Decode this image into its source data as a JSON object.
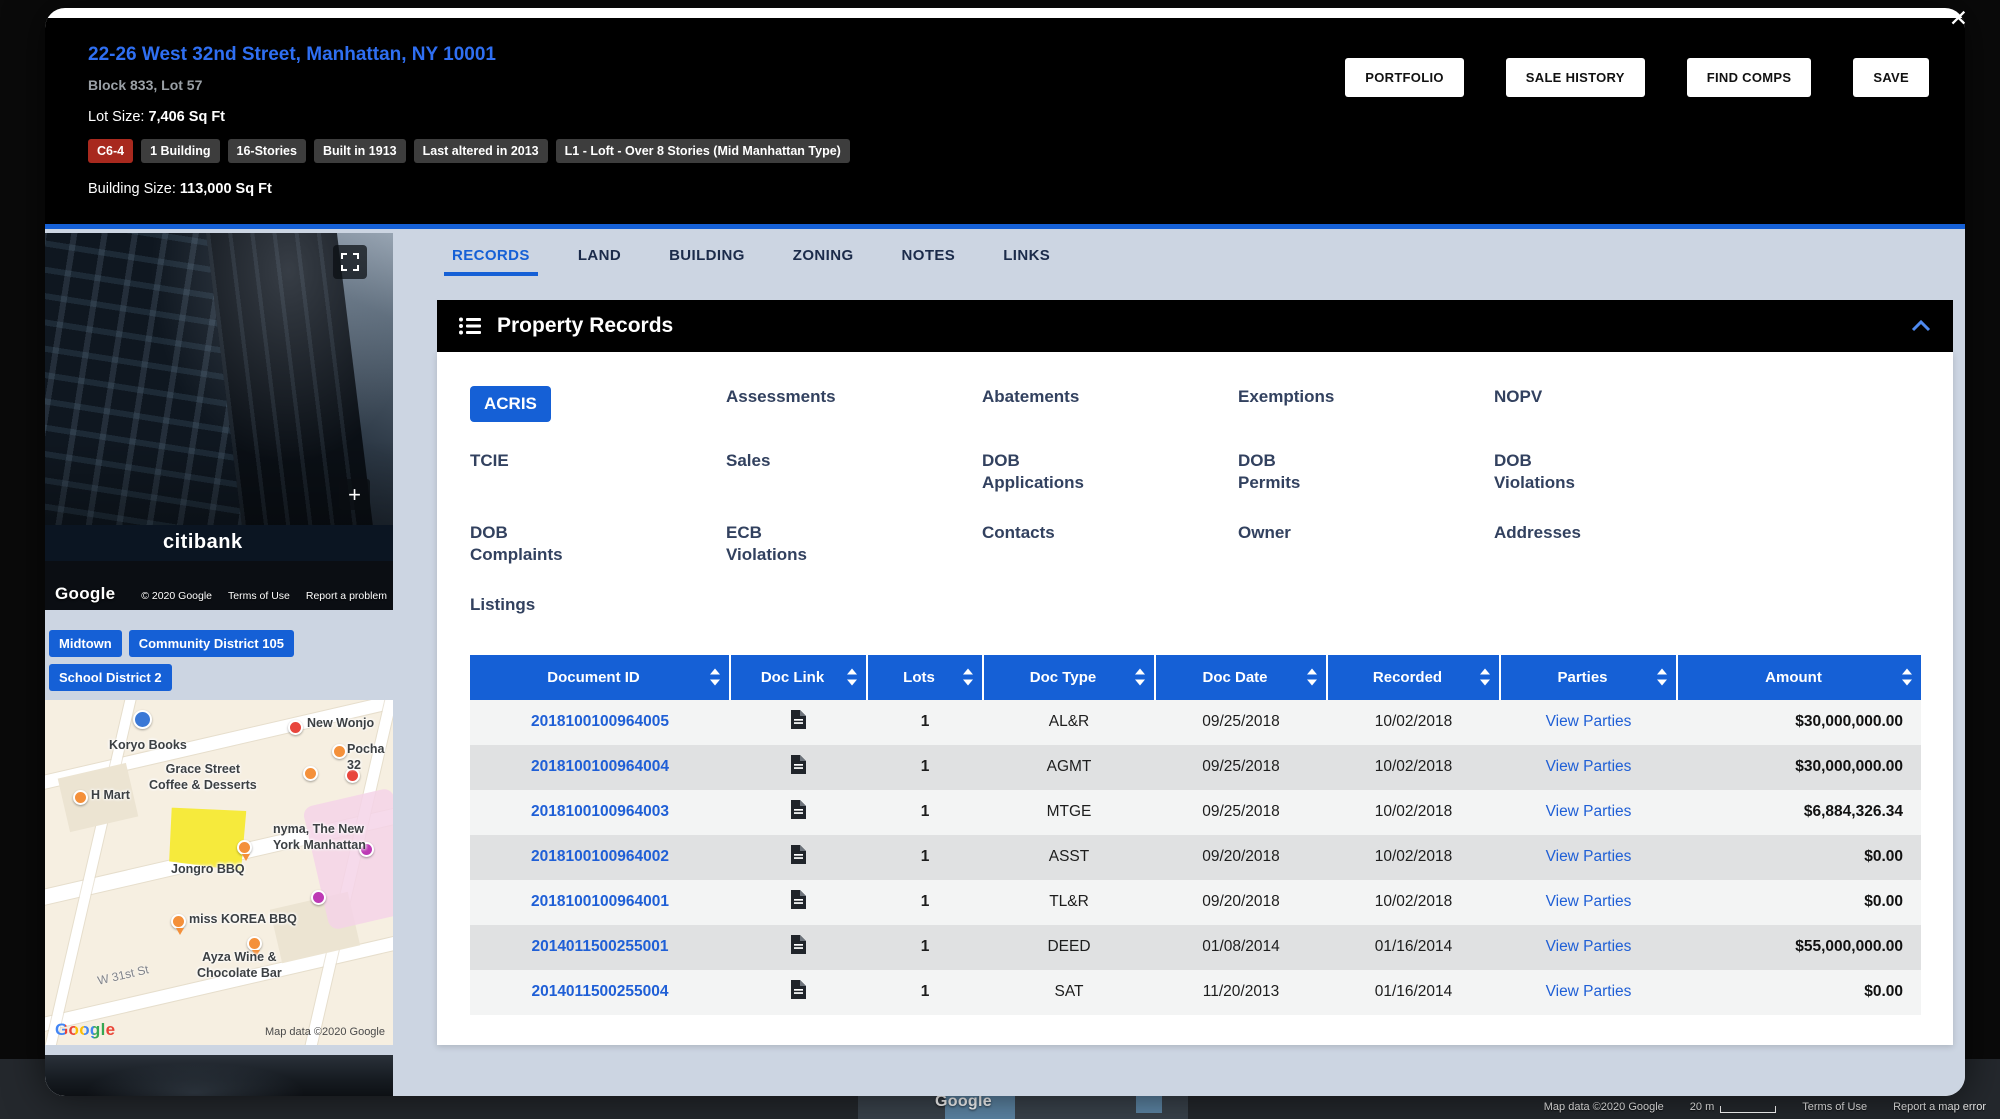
{
  "window": {
    "close_glyph": "✕"
  },
  "header": {
    "title": "22-26 West 32nd Street, Manhattan, NY 10001",
    "block_lot": "Block 833, Lot 57",
    "lot_size_label": "Lot Size:",
    "lot_size_value": "7,406 Sq Ft",
    "tags": [
      "C6-4",
      "1 Building",
      "16-Stories",
      "Built in 1913",
      "Last altered in 2013",
      "L1 - Loft - Over 8 Stories (Mid Manhattan Type)"
    ],
    "building_size_label": "Building Size:",
    "building_size_value": "113,000 Sq Ft",
    "buttons": [
      "PORTFOLIO",
      "SALE HISTORY",
      "FIND COMPS",
      "SAVE"
    ]
  },
  "sidebar": {
    "streetview": {
      "sign": "citibank",
      "zoom_in": "+",
      "google_logo": "Google",
      "copyright": "© 2020 Google",
      "terms": "Terms of Use",
      "report": "Report a problem"
    },
    "tags": [
      "Midtown",
      "Community District 105",
      "School District 2"
    ],
    "map": {
      "pois": [
        "Koryo Books",
        "New Wonjo",
        "Pocha 32",
        "Grace Street\nCoffee & Desserts",
        "H Mart",
        "nyma, The New\nYork Manhattan",
        "Jongro BBQ",
        "miss KOREA BBQ",
        "Ayza Wine &\nChocolate Bar"
      ],
      "street_label": "W 31st St",
      "google_logo": "Google",
      "attribution": "Map data ©2020 Google"
    }
  },
  "tabs": [
    "RECORDS",
    "LAND",
    "BUILDING",
    "ZONING",
    "NOTES",
    "LINKS"
  ],
  "records_panel": {
    "title": "Property Records",
    "nav": [
      "ACRIS",
      "Assessments",
      "Abatements",
      "Exemptions",
      "NOPV",
      "TCIE",
      "Sales",
      "DOB\nApplications",
      "DOB\nPermits",
      "DOB\nViolations",
      "DOB\nComplaints",
      "ECB\nViolations",
      "Contacts",
      "Owner",
      "Addresses",
      "Listings"
    ]
  },
  "table": {
    "columns": [
      "Document ID",
      "Doc Link",
      "Lots",
      "Doc Type",
      "Doc Date",
      "Recorded",
      "Parties",
      "Amount"
    ],
    "rows": [
      {
        "document_id": "2018100100964005",
        "lots": "1",
        "doc_type": "AL&R",
        "doc_date": "09/25/2018",
        "recorded": "10/02/2018",
        "parties": "View Parties",
        "amount": "$30,000,000.00"
      },
      {
        "document_id": "2018100100964004",
        "lots": "1",
        "doc_type": "AGMT",
        "doc_date": "09/25/2018",
        "recorded": "10/02/2018",
        "parties": "View Parties",
        "amount": "$30,000,000.00"
      },
      {
        "document_id": "2018100100964003",
        "lots": "1",
        "doc_type": "MTGE",
        "doc_date": "09/25/2018",
        "recorded": "10/02/2018",
        "parties": "View Parties",
        "amount": "$6,884,326.34"
      },
      {
        "document_id": "2018100100964002",
        "lots": "1",
        "doc_type": "ASST",
        "doc_date": "09/20/2018",
        "recorded": "10/02/2018",
        "parties": "View Parties",
        "amount": "$0.00"
      },
      {
        "document_id": "2018100100964001",
        "lots": "1",
        "doc_type": "TL&R",
        "doc_date": "09/20/2018",
        "recorded": "10/02/2018",
        "parties": "View Parties",
        "amount": "$0.00"
      },
      {
        "document_id": "2014011500255001",
        "lots": "1",
        "doc_type": "DEED",
        "doc_date": "01/08/2014",
        "recorded": "01/16/2014",
        "parties": "View Parties",
        "amount": "$55,000,000.00"
      },
      {
        "document_id": "2014011500255004",
        "lots": "1",
        "doc_type": "SAT",
        "doc_date": "11/20/2013",
        "recorded": "01/16/2014",
        "parties": "View Parties",
        "amount": "$0.00"
      }
    ]
  },
  "background_map": {
    "google_logo": "Google",
    "attribution": "Map data ©2020 Google",
    "scale": "20 m",
    "terms": "Terms of Use",
    "report": "Report a map error"
  },
  "colors": {
    "primary_blue": "#1560d6",
    "zoning_red": "#a8291e",
    "body_bg": "#ccd5e2",
    "header_bg": "#000000"
  }
}
